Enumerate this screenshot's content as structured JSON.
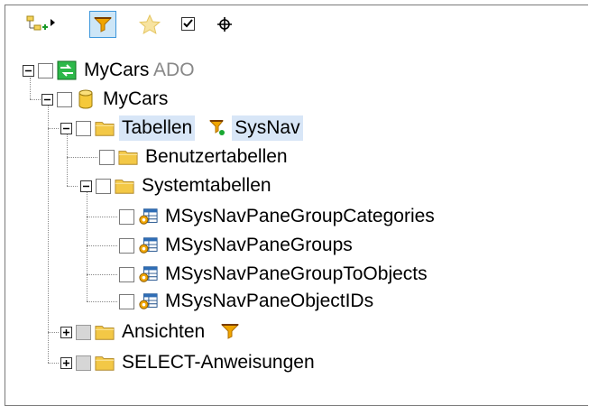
{
  "toolbar": {
    "buttons": [
      {
        "name": "add-tree-icon",
        "active": false
      },
      {
        "name": "filter-icon",
        "active": true
      },
      {
        "name": "favorites-star-icon",
        "active": false
      },
      {
        "name": "checkbox-toggle-icon",
        "active": false
      },
      {
        "name": "locate-crosshair-icon",
        "active": false
      }
    ]
  },
  "tree": {
    "root": {
      "label": "MyCars",
      "suffix": "ADO"
    },
    "db": {
      "label": "MyCars"
    },
    "tables": {
      "label": "Tabellen",
      "filter_label": "SysNav"
    },
    "user_tables": {
      "label": "Benutzertabellen"
    },
    "system_tables": {
      "label": "Systemtabellen"
    },
    "system_items": [
      "MSysNavPaneGroupCategories",
      "MSysNavPaneGroups",
      "MSysNavPaneGroupToObjects",
      "MSysNavPaneObjectIDs"
    ],
    "views": {
      "label": "Ansichten"
    },
    "select_statements": {
      "label": "SELECT-Anweisungen"
    }
  },
  "colors": {
    "selection": "#d8e6f7",
    "active_button": "#cde6f7",
    "folder": "#f3c846",
    "filter": "#f0a500"
  }
}
